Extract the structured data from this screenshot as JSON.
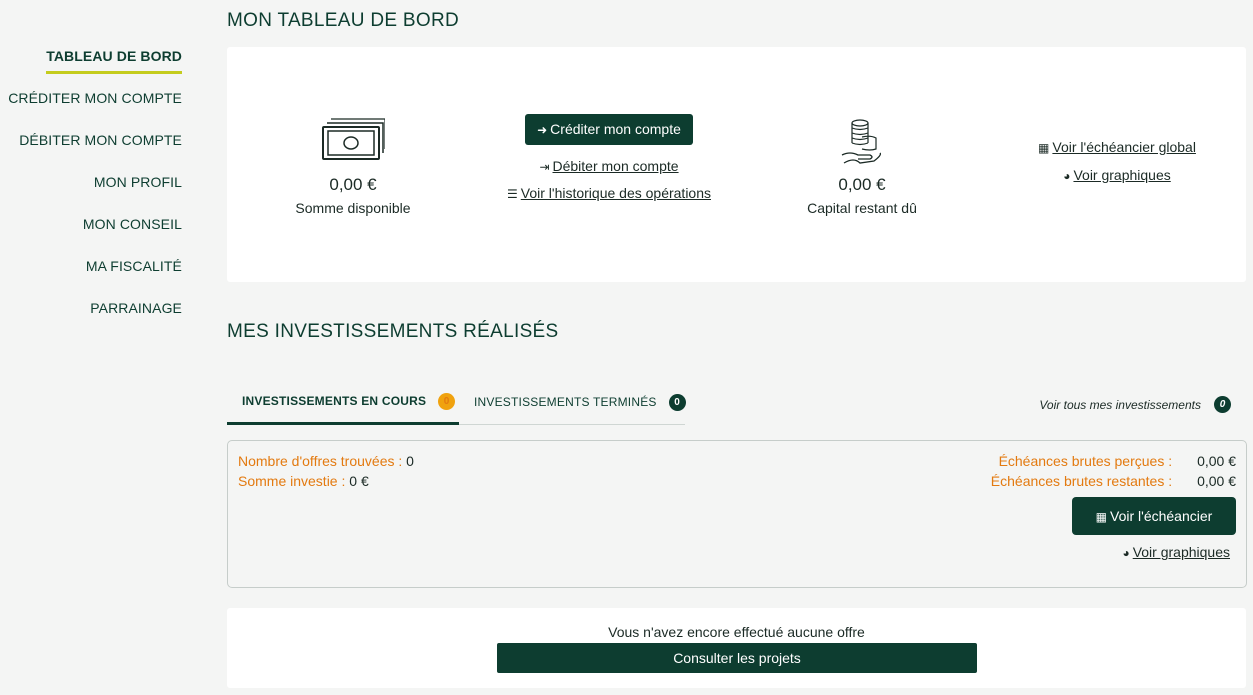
{
  "sidebar": {
    "items": [
      {
        "label": "TABLEAU DE BORD"
      },
      {
        "label": "CRÉDITER MON COMPTE"
      },
      {
        "label": "DÉBITER MON COMPTE"
      },
      {
        "label": "MON PROFIL"
      },
      {
        "label": "MON CONSEIL"
      },
      {
        "label": "MA FISCALITÉ"
      },
      {
        "label": "PARRAINAGE"
      }
    ]
  },
  "dashboard": {
    "title": "MON TABLEAU DE BORD",
    "available": {
      "amount": "0,00 €",
      "label": "Somme disponible"
    },
    "credit_button": "Créditer mon compte",
    "debit_link": "Débiter mon compte",
    "history_link": "Voir l'historique des opérations",
    "capital": {
      "amount": "0,00 €",
      "label": "Capital restant dû"
    },
    "schedule_link": "Voir l'échéancier global",
    "graphs_link": "Voir graphiques"
  },
  "investments": {
    "title": "MES INVESTISSEMENTS RÉALISÉS",
    "tabs": [
      {
        "label": "INVESTISSEMENTS EN COURS",
        "count": "0"
      },
      {
        "label": "INVESTISSEMENTS TERMINÉS",
        "count": "0"
      }
    ],
    "see_all": {
      "label": "Voir tous mes investissements",
      "count": "0"
    },
    "offers_found": {
      "label": "Nombre d'offres trouvées :",
      "value": "0"
    },
    "invested": {
      "label": "Somme investie :",
      "value": "0 €"
    },
    "received": {
      "label": "Échéances brutes perçues :",
      "value": "0,00 €"
    },
    "remaining": {
      "label": "Échéances brutes restantes :",
      "value": "0,00 €"
    },
    "schedule_button": "Voir l'échéancier",
    "graphs_link": "Voir graphiques"
  },
  "empty": {
    "message": "Vous n'avez encore effectué aucune offre",
    "button": "Consulter les projets"
  },
  "colors": {
    "primary": "#0d3d30",
    "accent": "#c4cc1d",
    "orange": "#e37a10",
    "badge_orange": "#f0a20e"
  }
}
